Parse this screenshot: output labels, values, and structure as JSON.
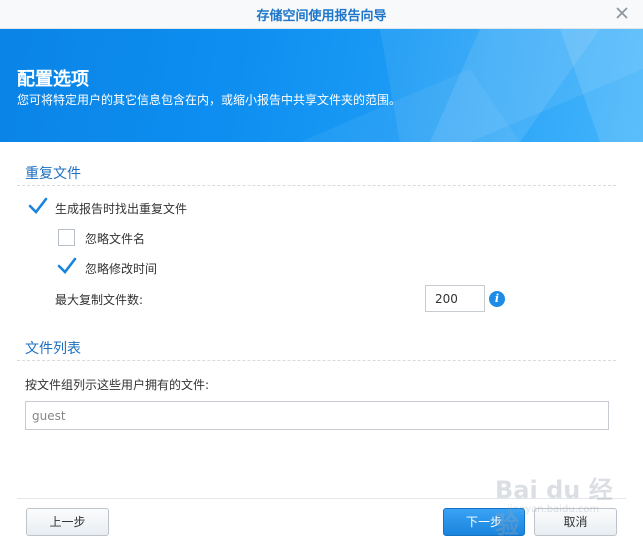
{
  "window": {
    "title": "存储空间使用报告向导"
  },
  "banner": {
    "title": "配置选项",
    "description": "您可将特定用户的其它信息包含在内，或缩小报告中共享文件夹的范围。"
  },
  "duplicate_files": {
    "section_title": "重复文件",
    "find_duplicates": {
      "label": "生成报告时找出重复文件",
      "checked": true
    },
    "ignore_filename": {
      "label": "忽略文件名",
      "checked": false
    },
    "ignore_modified_time": {
      "label": "忽略修改时间",
      "checked": true
    },
    "max_copies": {
      "label": "最大复制文件数:",
      "value": "200"
    }
  },
  "file_list": {
    "section_title": "文件列表",
    "instruction": "按文件组列示这些用户拥有的文件:",
    "users_value": "guest"
  },
  "footer": {
    "back_label": "上一步",
    "next_label": "下一步",
    "cancel_label": "取消"
  },
  "watermark": {
    "brand": "Bai du 经验",
    "url": "jingyan.baidu.com"
  },
  "colors": {
    "accent": "#1d76c9",
    "banner": "#0d8ef0",
    "primary_button": "#1a84dd"
  }
}
